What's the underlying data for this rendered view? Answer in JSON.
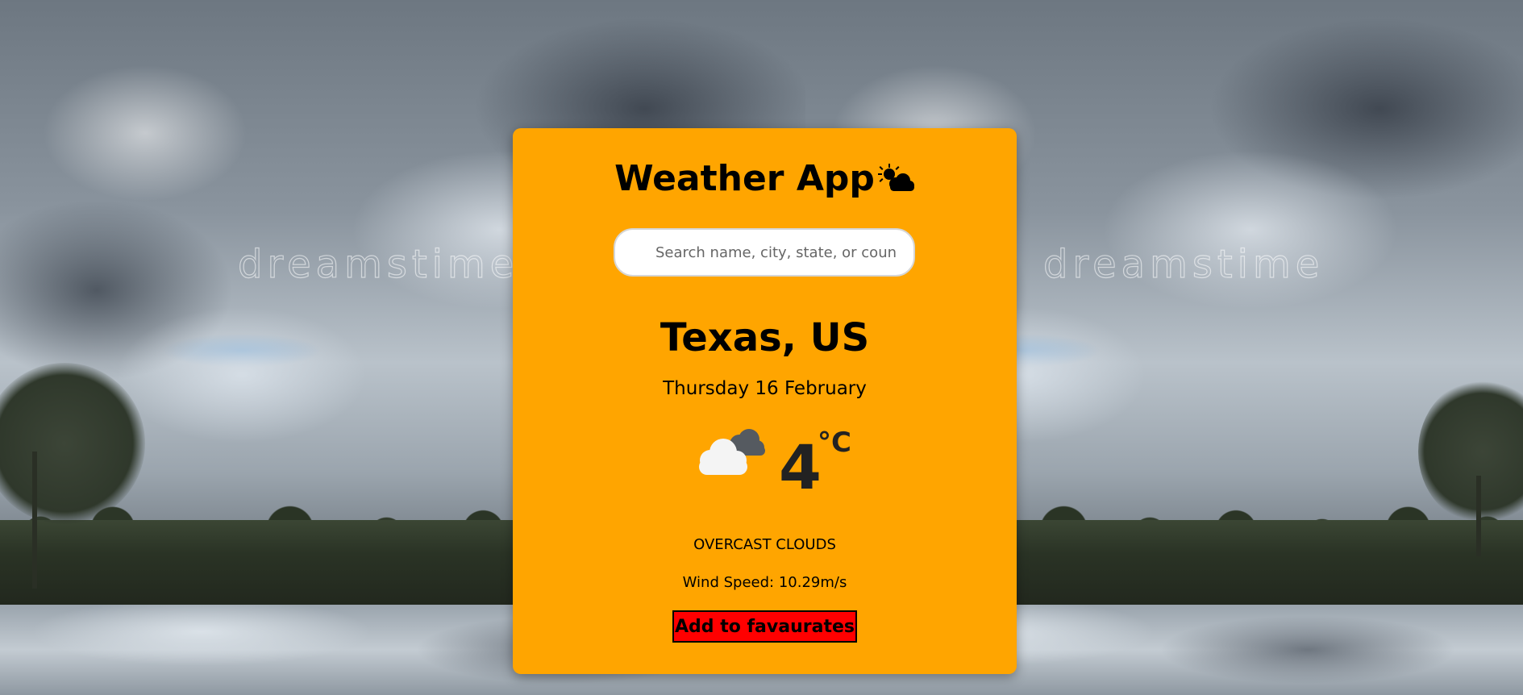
{
  "app": {
    "title": "Weather App",
    "title_icon": "sun-behind-cloud-icon"
  },
  "search": {
    "placeholder": "Search name, city, state, or country",
    "value": ""
  },
  "location": {
    "name": "Texas, US"
  },
  "date": {
    "text": "Thursday 16 February"
  },
  "weather": {
    "icon": "overcast-clouds-icon",
    "temperature": "4",
    "unit": "°C",
    "description": "OVERCAST CLOUDS",
    "wind": "Wind Speed: 10.29m/s"
  },
  "actions": {
    "favourite_label": "Add to favaurates"
  },
  "background": {
    "watermark": "dreamstime"
  },
  "colors": {
    "card": "#ffa500",
    "button": "#ff0000",
    "text": "#000000"
  }
}
